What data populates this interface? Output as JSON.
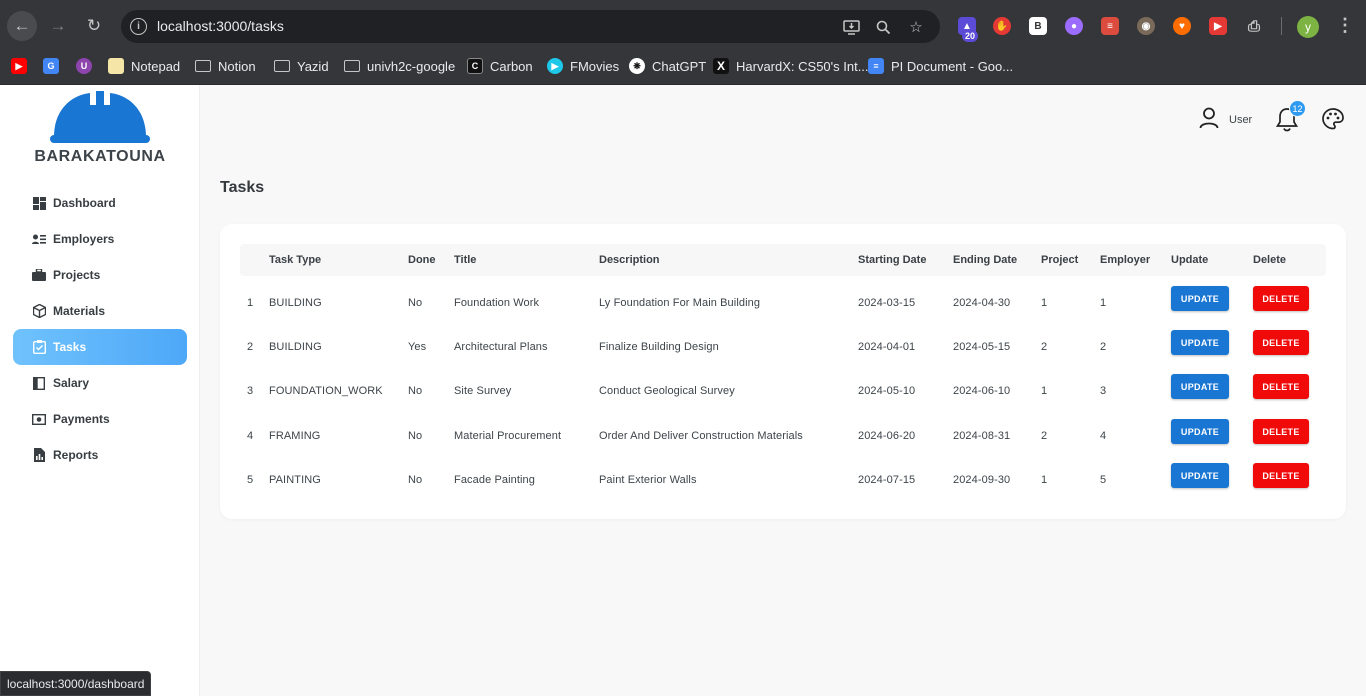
{
  "browser": {
    "url": "localhost:3000/tasks",
    "ext_badge": "20",
    "profile_initial": "y",
    "bookmarks": [
      {
        "label": "",
        "icon": "youtube-icon",
        "color": "#ff0000"
      },
      {
        "label": "",
        "icon": "google-translate-icon",
        "color": "#4285f4"
      },
      {
        "label": "",
        "icon": "ublock-icon",
        "color": "#8e44ad"
      },
      {
        "label": "Notepad",
        "icon": "notepad-icon",
        "color": "#f5e6a8"
      },
      {
        "label": "Notion",
        "icon": "folder-icon"
      },
      {
        "label": "Yazid",
        "icon": "folder-icon"
      },
      {
        "label": "univh2c-google",
        "icon": "folder-icon"
      },
      {
        "label": "Carbon",
        "icon": "carbon-icon",
        "color": "#111111"
      },
      {
        "label": "FMovies",
        "icon": "fmovies-icon",
        "color": "#1ec8e8"
      },
      {
        "label": "ChatGPT",
        "icon": "chatgpt-icon",
        "color": "#ffffff"
      },
      {
        "label": "HarvardX: CS50's Int...",
        "icon": "edx-icon",
        "color": "#111111"
      },
      {
        "label": "PI Document - Goo...",
        "icon": "google-docs-icon",
        "color": "#4285f4"
      }
    ],
    "status_url": "localhost:3000/dashboard"
  },
  "sidebar": {
    "brand": "BARAKATOUNA",
    "items": [
      {
        "label": "Dashboard",
        "icon": "dashboard-icon",
        "active": false
      },
      {
        "label": "Employers",
        "icon": "employers-icon",
        "active": false
      },
      {
        "label": "Projects",
        "icon": "briefcase-icon",
        "active": false
      },
      {
        "label": "Materials",
        "icon": "cube-icon",
        "active": false
      },
      {
        "label": "Tasks",
        "icon": "checklist-icon",
        "active": true
      },
      {
        "label": "Salary",
        "icon": "salary-icon",
        "active": false
      },
      {
        "label": "Payments",
        "icon": "payments-icon",
        "active": false
      },
      {
        "label": "Reports",
        "icon": "reports-icon",
        "active": false
      }
    ]
  },
  "header": {
    "user_label": "User",
    "notification_count": "12"
  },
  "page": {
    "title": "Tasks"
  },
  "table": {
    "columns": [
      "",
      "Task Type",
      "Done",
      "Title",
      "Description",
      "Starting Date",
      "Ending Date",
      "Project",
      "Employer",
      "Update",
      "Delete"
    ],
    "update_label": "UPDATE",
    "delete_label": "DELETE",
    "rows": [
      {
        "id": "1",
        "task_type": "BUILDING",
        "done": "No",
        "title": "Foundation Work",
        "description": "Ly Foundation For Main Building",
        "start": "2024-03-15",
        "end": "2024-04-30",
        "project": "1",
        "employer": "1"
      },
      {
        "id": "2",
        "task_type": "BUILDING",
        "done": "Yes",
        "title": "Architectural Plans",
        "description": "Finalize Building Design",
        "start": "2024-04-01",
        "end": "2024-05-15",
        "project": "2",
        "employer": "2"
      },
      {
        "id": "3",
        "task_type": "FOUNDATION_WORK",
        "done": "No",
        "title": "Site Survey",
        "description": "Conduct Geological Survey",
        "start": "2024-05-10",
        "end": "2024-06-10",
        "project": "1",
        "employer": "3"
      },
      {
        "id": "4",
        "task_type": "FRAMING",
        "done": "No",
        "title": "Material Procurement",
        "description": "Order And Deliver Construction Materials",
        "start": "2024-06-20",
        "end": "2024-08-31",
        "project": "2",
        "employer": "4"
      },
      {
        "id": "5",
        "task_type": "PAINTING",
        "done": "No",
        "title": "Facade Painting",
        "description": "Paint Exterior Walls",
        "start": "2024-07-15",
        "end": "2024-09-30",
        "project": "1",
        "employer": "5"
      }
    ]
  }
}
